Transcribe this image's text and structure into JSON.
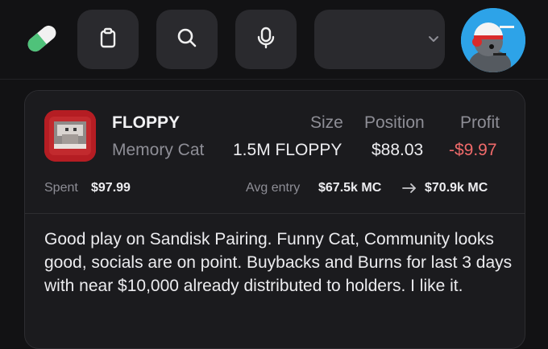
{
  "topbar": {
    "logo_icon": "pill-icon",
    "clipboard_icon": "clipboard-icon",
    "search_icon": "search-icon",
    "mic_icon": "microphone-icon",
    "select_value": "",
    "select_icon": "chevron-down-icon",
    "avatar_icon": "avatar-image"
  },
  "card": {
    "token_icon": "token-image",
    "symbol": "FLOPPY",
    "name": "Memory Cat",
    "columns": {
      "size_label": "Size",
      "position_label": "Position",
      "profit_label": "Profit"
    },
    "size_value": "1.5M FLOPPY",
    "position_value": "$88.03",
    "profit_value": "-$9.97",
    "spent_label": "Spent",
    "spent_value": "$97.99",
    "avg_entry_label": "Avg entry",
    "avg_entry_value": "$67.5k MC",
    "arrow_icon": "arrow-right-icon",
    "current_mc_value": "$70.9k MC",
    "comment": "Good play on Sandisk Pairing. Funny Cat, Community looks good, socials are on point. Buybacks and Burns for last 3 days with near $10,000 already distributed to holders. I like it."
  },
  "colors": {
    "background": "#121214",
    "surface": "#2a2a2e",
    "card": "#1b1b1e",
    "negative": "#f06a6a",
    "pill_green": "#4fc27a",
    "avatar_blue": "#2da3e8"
  }
}
